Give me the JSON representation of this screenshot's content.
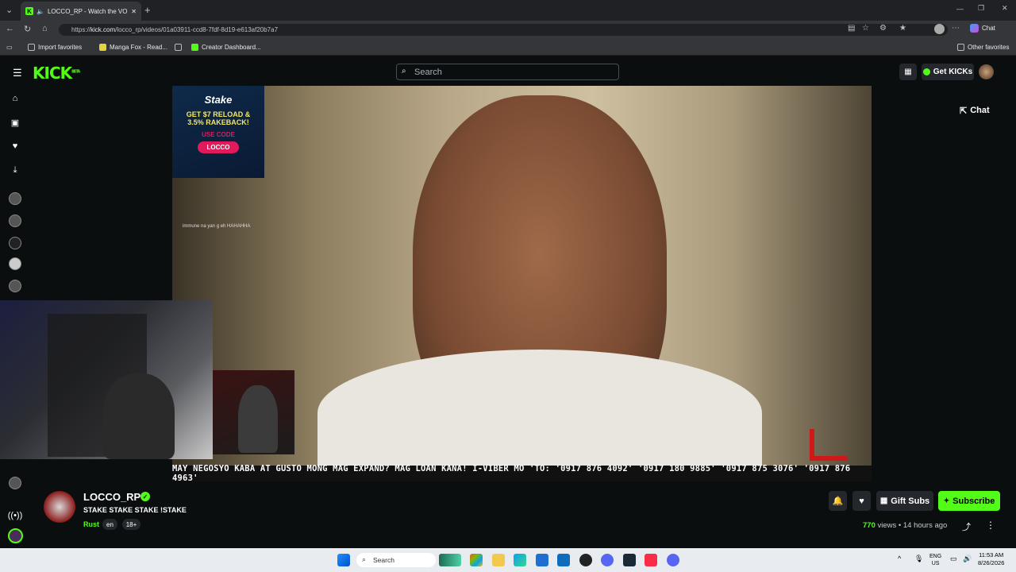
{
  "browser": {
    "tab_title": "LOCCO_RP - Watch the VOD",
    "url_domain": "kick.com",
    "url_scheme": "https://",
    "url_path": "/locco_rp/videos/01a03911-ccd8-7fdf-8d19-e613af20b7a7",
    "chat_label": "Chat",
    "bookmarks": [
      "Import favorites",
      "Manga Fox - Read...",
      "Creator Dashboard..."
    ],
    "other_favorites": "Other favorites"
  },
  "kick": {
    "logo": "KICK",
    "logo_badge": "BETA",
    "search_placeholder": "Search",
    "get_kicks": "Get KICKs",
    "chat_button": "Chat"
  },
  "video": {
    "ad_brand": "Stake",
    "ad_line1": "GET $7 RELOAD &",
    "ad_line2": "3.5% RAKEBACK!",
    "ad_use_code": "USE CODE",
    "ad_code": "LOCCO",
    "chat_overlay": "immune na yan g eh HAHAHHA",
    "ticker": "MAY NEGOSYO KABA AT GUSTO MONG MAG EXPAND? MAG LOAN KANA! I-VIBER MO 'TO: '0917 876 4092' '0917 180 9885' '0917 875 3076' '0917 876 4963'"
  },
  "stream": {
    "username": "LOCCO_RP",
    "title": "STAKE STAKE STAKE !STAKE",
    "category": "Rust",
    "language": "en",
    "age": "18+",
    "views": "770",
    "views_label": "views",
    "separator": "•",
    "time_ago": "14 hours ago",
    "gift_subs": "Gift Subs",
    "subscribe": "Subscribe"
  },
  "taskbar": {
    "search": "Search",
    "lang1": "ENG",
    "lang2": "US",
    "time": "11:53 AM",
    "date": "8/26/2026"
  },
  "colors": {
    "accent": "#53fc18",
    "bg": "#0b0e0f"
  }
}
